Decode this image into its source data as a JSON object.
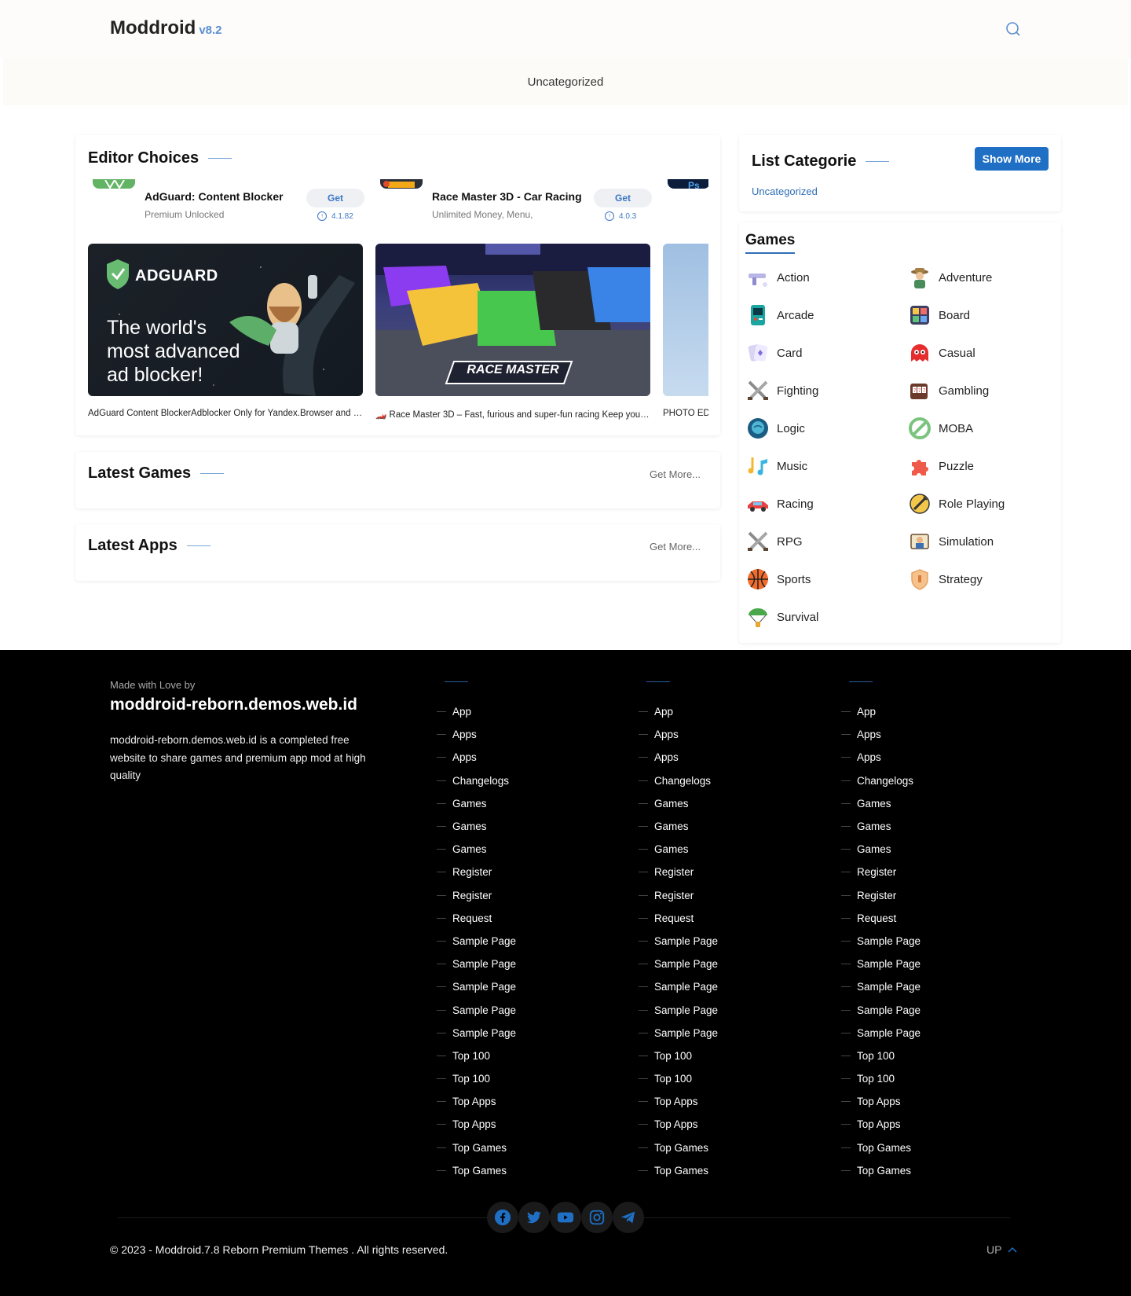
{
  "header": {
    "brand": "Moddroid",
    "version": "v8.2",
    "category_link": "Uncategorized"
  },
  "editor_choices": {
    "title": "Editor Choices",
    "items": [
      {
        "name": "AdGuard: Content Blocker",
        "subtitle": "Premium Unlocked",
        "get_label": "Get",
        "version": "4.1.82",
        "banner_text": "ADGUARD",
        "banner_tagline_1": "The world's",
        "banner_tagline_2": "most advanced",
        "banner_tagline_3": "ad blocker!",
        "description": "AdGuard Content BlockerAdblocker Only for Yandex.Browser and Samsung Internet"
      },
      {
        "name": "Race Master 3D - Car Racing",
        "subtitle": "Unlimited Money, Menu,",
        "get_label": "Get",
        "version": "4.0.3",
        "banner_text": "RACE MASTER",
        "description": "🏎️ Race Master 3D – Fast, furious and super-fun racing Keep your foot on the gas"
      },
      {
        "description": "PHOTO EDITOR"
      }
    ]
  },
  "latest_games": {
    "title": "Latest Games",
    "more": "Get More..."
  },
  "latest_apps": {
    "title": "Latest Apps",
    "more": "Get More..."
  },
  "list_categorie": {
    "title": "List Categorie",
    "show_more": "Show More",
    "link": "Uncategorized"
  },
  "games": {
    "title": "Games",
    "categories": [
      {
        "label": "Action",
        "icon": "gun-icon"
      },
      {
        "label": "Adventure",
        "icon": "explorer-icon"
      },
      {
        "label": "Arcade",
        "icon": "arcade-machine-icon"
      },
      {
        "label": "Board",
        "icon": "board-game-icon"
      },
      {
        "label": "Card",
        "icon": "cards-icon"
      },
      {
        "label": "Casual",
        "icon": "ghost-icon"
      },
      {
        "label": "Fighting",
        "icon": "crossed-swords-icon"
      },
      {
        "label": "Gambling",
        "icon": "slot-machine-icon"
      },
      {
        "label": "Logic",
        "icon": "brain-icon"
      },
      {
        "label": "MOBA",
        "icon": "no-entry-icon"
      },
      {
        "label": "Music",
        "icon": "music-notes-icon"
      },
      {
        "label": "Puzzle",
        "icon": "puzzle-piece-icon"
      },
      {
        "label": "Racing",
        "icon": "race-car-icon"
      },
      {
        "label": "Role Playing",
        "icon": "shield-sword-icon"
      },
      {
        "label": "RPG",
        "icon": "crossed-swords-icon"
      },
      {
        "label": "Simulation",
        "icon": "simulation-icon"
      },
      {
        "label": "Sports",
        "icon": "basketball-icon"
      },
      {
        "label": "Strategy",
        "icon": "strategy-shield-icon"
      },
      {
        "label": "Survival",
        "icon": "parachute-icon"
      }
    ]
  },
  "footer": {
    "made_with": "Made with Love by",
    "site": "moddroid-reborn.demos.web.id",
    "about": "moddroid-reborn.demos.web.id is a completed free website to share games and premium app mod at high quality",
    "links": [
      "App",
      "Apps",
      "Apps",
      "Changelogs",
      "Games",
      "Games",
      "Games",
      "Register",
      "Register",
      "Request",
      "Sample Page",
      "Sample Page",
      "Sample Page",
      "Sample Page",
      "Sample Page",
      "Top 100",
      "Top 100",
      "Top Apps",
      "Top Apps",
      "Top Games",
      "Top Games"
    ],
    "copyright": "© 2023 - Moddroid.7.8 Reborn Premium Themes . All rights reserved.",
    "up": "UP"
  },
  "colors": {
    "accent": "#1f6fc4",
    "footer_bg": "#000000"
  }
}
